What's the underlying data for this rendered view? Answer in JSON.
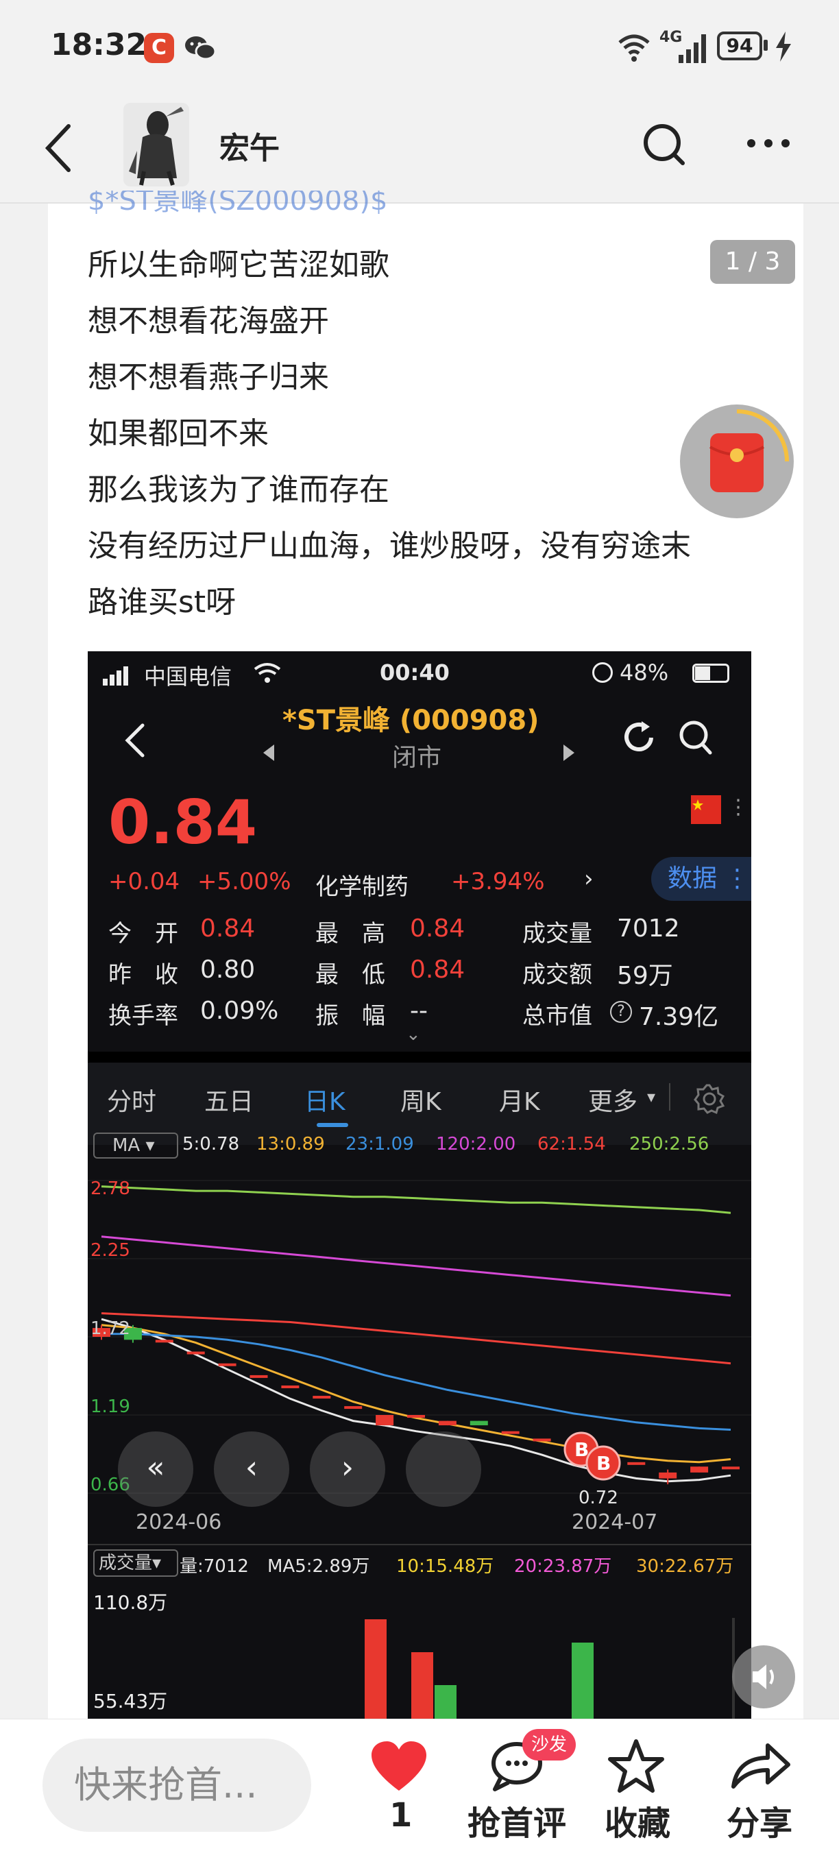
{
  "status": {
    "time": "18:32",
    "network": "4G",
    "battery": "94"
  },
  "header": {
    "username": "宏午"
  },
  "post": {
    "truncated_tag": "$*ST景峰(SZ000908)$",
    "page_indicator": "1 / 3",
    "lines": [
      "所以生命啊它苦涩如歌",
      "想不想看花海盛开",
      "想不想看燕子归来",
      "如果都回不来",
      "那么我该为了谁而存在",
      "没有经历过尸山血海，谁炒股呀，没有穷途末",
      "路谁买st呀"
    ]
  },
  "screenshot": {
    "status": {
      "carrier": "中国电信",
      "time": "00:40",
      "battery": "48%"
    },
    "title": "*ST景峰 (000908)",
    "market_state": "闭市",
    "price": "0.84",
    "change": "+0.04",
    "change_pct": "+5.00%",
    "sector": "化学制药",
    "sector_pct": "+3.94%",
    "data_btn": "数据",
    "stats": {
      "open_label": "今　开",
      "open": "0.84",
      "high_label": "最　高",
      "high": "0.84",
      "volume_label": "成交量",
      "volume": "7012",
      "prev_label": "昨　收",
      "prev": "0.80",
      "low_label": "最　低",
      "low": "0.84",
      "amount_label": "成交额",
      "amount": "59万",
      "turnover_label": "换手率",
      "turnover": "0.09%",
      "amp_label": "振　幅",
      "amp": "--",
      "mcap_label": "总市值",
      "mcap": "7.39亿"
    },
    "tabs": [
      "分时",
      "五日",
      "日K",
      "周K",
      "月K",
      "更多"
    ],
    "active_tab": "日K",
    "ma": {
      "selector": "MA",
      "items": [
        "5:0.78",
        "13:0.89",
        "23:1.09",
        "120:2.00",
        "62:1.54",
        "250:2.56"
      ],
      "colors": [
        "#e8e8e8",
        "#f2b233",
        "#3a8fdd",
        "#d64ad6",
        "#f2413a",
        "#8fd14f"
      ]
    },
    "chart_data": {
      "type": "line",
      "title": "",
      "xlabel": "",
      "ylabel": "",
      "x_ticks": [
        "2024-06",
        "2024-07"
      ],
      "y_ticks": [
        "2.78",
        "2.25",
        "1.72",
        "1.19",
        "0.66"
      ],
      "ylim": [
        0.66,
        2.78
      ],
      "annotation_low": "0.72",
      "markers": [
        "B",
        "B"
      ],
      "series": [
        {
          "name": "5:0.78",
          "color": "#e8e8e8",
          "values": [
            1.84,
            1.78,
            1.7,
            1.6,
            1.5,
            1.4,
            1.3,
            1.22,
            1.15,
            1.12,
            1.08,
            1.05,
            1.02,
            0.98,
            0.92,
            0.85,
            0.8,
            0.76,
            0.74,
            0.75,
            0.78
          ]
        },
        {
          "name": "13:0.89",
          "color": "#f2b233",
          "values": [
            1.8,
            1.78,
            1.74,
            1.68,
            1.6,
            1.52,
            1.44,
            1.36,
            1.28,
            1.22,
            1.17,
            1.13,
            1.09,
            1.05,
            1.01,
            0.97,
            0.93,
            0.9,
            0.88,
            0.87,
            0.89
          ]
        },
        {
          "name": "23:1.09",
          "color": "#3a8fdd",
          "values": [
            1.74,
            1.74,
            1.73,
            1.72,
            1.7,
            1.67,
            1.63,
            1.58,
            1.52,
            1.46,
            1.41,
            1.36,
            1.32,
            1.28,
            1.24,
            1.2,
            1.17,
            1.14,
            1.12,
            1.1,
            1.09
          ]
        },
        {
          "name": "62:1.54",
          "color": "#f2413a",
          "values": [
            1.88,
            1.87,
            1.86,
            1.85,
            1.84,
            1.83,
            1.82,
            1.8,
            1.78,
            1.76,
            1.74,
            1.72,
            1.7,
            1.68,
            1.66,
            1.64,
            1.62,
            1.6,
            1.58,
            1.56,
            1.54
          ]
        },
        {
          "name": "120:2.00",
          "color": "#d64ad6",
          "values": [
            2.4,
            2.38,
            2.36,
            2.34,
            2.32,
            2.3,
            2.28,
            2.26,
            2.24,
            2.22,
            2.2,
            2.18,
            2.16,
            2.14,
            2.12,
            2.1,
            2.08,
            2.06,
            2.04,
            2.02,
            2.0
          ]
        },
        {
          "name": "250:2.56",
          "color": "#8fd14f",
          "values": [
            2.74,
            2.73,
            2.72,
            2.71,
            2.71,
            2.7,
            2.69,
            2.68,
            2.67,
            2.67,
            2.66,
            2.65,
            2.64,
            2.63,
            2.63,
            2.62,
            2.61,
            2.6,
            2.59,
            2.58,
            2.56
          ]
        }
      ],
      "candles": [
        {
          "o": 1.72,
          "c": 1.78,
          "h": 1.8,
          "l": 1.7
        },
        {
          "o": 1.78,
          "c": 1.7,
          "h": 1.8,
          "l": 1.68
        },
        {
          "o": 1.7,
          "c": 1.7,
          "h": 1.7,
          "l": 1.7
        },
        {
          "o": 1.62,
          "c": 1.62,
          "h": 1.62,
          "l": 1.62
        },
        {
          "o": 1.54,
          "c": 1.54,
          "h": 1.54,
          "l": 1.54
        },
        {
          "o": 1.46,
          "c": 1.46,
          "h": 1.46,
          "l": 1.46
        },
        {
          "o": 1.39,
          "c": 1.39,
          "h": 1.39,
          "l": 1.39
        },
        {
          "o": 1.32,
          "c": 1.32,
          "h": 1.32,
          "l": 1.32
        },
        {
          "o": 1.25,
          "c": 1.25,
          "h": 1.25,
          "l": 1.25
        },
        {
          "o": 1.12,
          "c": 1.19,
          "h": 1.19,
          "l": 1.12
        },
        {
          "o": 1.19,
          "c": 1.19,
          "h": 1.19,
          "l": 1.19
        },
        {
          "o": 1.12,
          "c": 1.15,
          "h": 1.15,
          "l": 1.12
        },
        {
          "o": 1.15,
          "c": 1.12,
          "h": 1.15,
          "l": 1.12
        },
        {
          "o": 1.08,
          "c": 1.08,
          "h": 1.08,
          "l": 1.08
        },
        {
          "o": 1.03,
          "c": 1.03,
          "h": 1.03,
          "l": 1.03
        },
        {
          "o": 0.97,
          "c": 0.97,
          "h": 0.97,
          "l": 0.97
        },
        {
          "o": 0.92,
          "c": 0.92,
          "h": 0.92,
          "l": 0.92
        },
        {
          "o": 0.87,
          "c": 0.87,
          "h": 0.87,
          "l": 0.87
        },
        {
          "o": 0.76,
          "c": 0.8,
          "h": 0.82,
          "l": 0.72
        },
        {
          "o": 0.8,
          "c": 0.84,
          "h": 0.84,
          "l": 0.8
        },
        {
          "o": 0.84,
          "c": 0.84,
          "h": 0.84,
          "l": 0.84
        }
      ]
    },
    "volume": {
      "selector": "成交量",
      "items": [
        "量:7012",
        "MA5:2.89万",
        "10:15.48万",
        "20:23.87万",
        "30:22.67万"
      ],
      "colors": [
        "#e6e6e6",
        "#e6e6e6",
        "#f2d233",
        "#f25ad6",
        "#f2b233"
      ],
      "y_ticks": [
        "110.8万",
        "55.43万"
      ]
    }
  },
  "bottom": {
    "comment_placeholder": "快来抢首...",
    "like_count": "1",
    "sofa_badge": "沙发",
    "first_comment": "抢首评",
    "favorite": "收藏",
    "share": "分享"
  }
}
